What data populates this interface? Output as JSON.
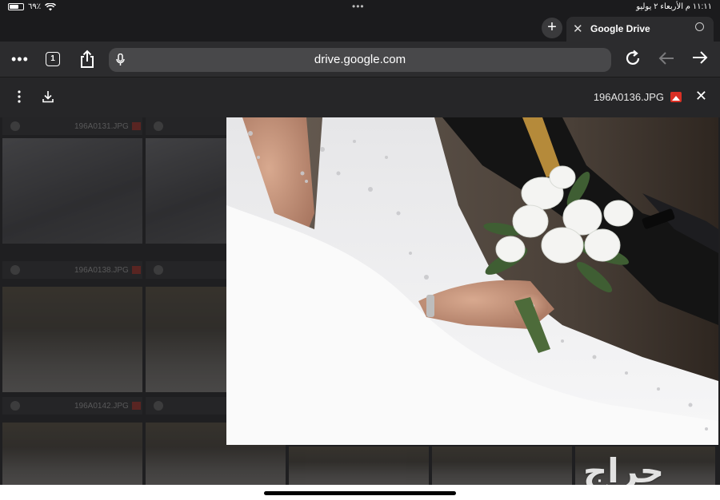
{
  "status_bar": {
    "time_date": "١١:١١ م  الأربعاء ٢ يوليو",
    "battery": "٦٩٪",
    "center_dots": "•••"
  },
  "tab_bar": {
    "new_tab": "+",
    "tab_close": "✕",
    "tab_title": "Google Drive"
  },
  "toolbar": {
    "menu_dots": "•••",
    "tabs_count": "1",
    "url": "drive.google.com"
  },
  "viewer": {
    "file_name": "196A0136.JPG",
    "close": "✕"
  },
  "grid": {
    "labels": [
      "196A0131.JPG",
      "196A0138.JPG",
      "196A0142.JPG"
    ]
  },
  "watermark": {
    "text": "حراج"
  },
  "colors": {
    "chrome_dark": "#1b1b1d",
    "toolbar": "#2c2c2e",
    "urlbar": "#48484a",
    "drive_red": "#d93025"
  }
}
